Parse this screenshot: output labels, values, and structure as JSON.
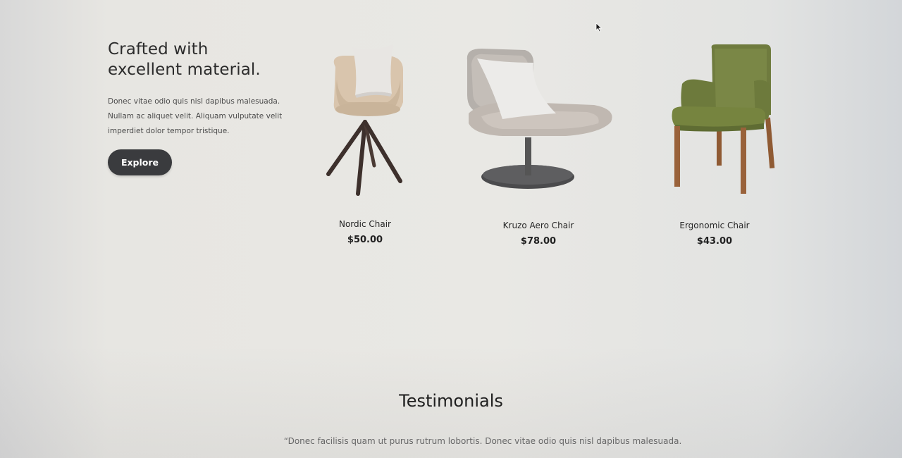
{
  "hero": {
    "title_line1": "Crafted with",
    "title_line2": "excellent material.",
    "description_line1": "Donec vitae odio quis nisl dapibus malesuada.",
    "description_line2": "Nullam ac aliquet velit. Aliquam vulputate velit",
    "description_line3": "imperdiet dolor tempor tristique.",
    "button_label": "Explore"
  },
  "products": [
    {
      "name": "Nordic Chair",
      "price": "$50.00",
      "icon": "nordic-chair-image"
    },
    {
      "name": "Kruzo Aero Chair",
      "price": "$78.00",
      "icon": "kruzo-aero-chair-image"
    },
    {
      "name": "Ergonomic Chair",
      "price": "$43.00",
      "icon": "ergonomic-chair-image"
    }
  ],
  "testimonials": {
    "title": "Testimonials",
    "quote": "“Donec facilisis quam ut purus rutrum lobortis. Donec vitae odio quis nisl dapibus malesuada."
  },
  "colors": {
    "background": "#e9e8e4",
    "button": "#3a3b3e",
    "text": "#2c2c2c"
  }
}
